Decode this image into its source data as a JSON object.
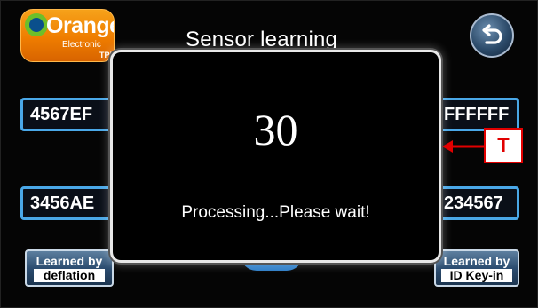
{
  "logo": {
    "brand": "Orange",
    "line1": "Electronic",
    "line2": "TPi"
  },
  "screen": {
    "title": "Sensor learning"
  },
  "sensor_ids": {
    "top_left": "4567EF",
    "top_right": "FFFFFF",
    "bottom_left": "3456AE",
    "bottom_right": "234567"
  },
  "buttons": {
    "learn_deflation": {
      "line1": "Learned by",
      "line2": "deflation"
    },
    "learn_id_keyin": {
      "line1": "Learned by",
      "line2": "ID Key-in"
    }
  },
  "dialog": {
    "countdown": "30",
    "message": "Processing...Please wait!"
  },
  "callout": {
    "label": "T",
    "color": "#e10000"
  },
  "colors": {
    "accent": "#4aa8e8",
    "brand": "#ef7d00",
    "background": "#050505"
  },
  "icons": {
    "back": "back-arrow-icon"
  }
}
